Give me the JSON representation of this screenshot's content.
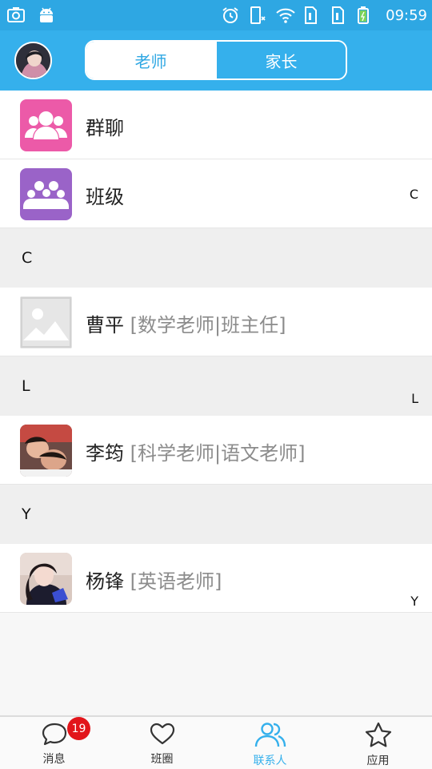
{
  "status_bar": {
    "time": "09:59",
    "left_icons": [
      "screenshot-icon",
      "android-icon"
    ],
    "right_icons": [
      "alarm-icon",
      "sim-call-icon",
      "wifi-icon",
      "sim1-icon",
      "sim2-icon",
      "battery-icon"
    ]
  },
  "header": {
    "tabs": [
      {
        "label": "老师",
        "active": true
      },
      {
        "label": "家长",
        "active": false
      }
    ]
  },
  "entries": [
    {
      "label": "群聊",
      "icon": "group-chat-icon",
      "color": "#ec5aa8"
    },
    {
      "label": "班级",
      "icon": "class-icon",
      "color": "#9a63c8",
      "index": "C"
    }
  ],
  "sections": [
    {
      "letter": "C",
      "contacts": [
        {
          "name": "曹平",
          "role": "[数学老师|班主任]",
          "avatar": "placeholder-image-icon"
        }
      ],
      "index": "L"
    },
    {
      "letter": "L",
      "contacts": [
        {
          "name": "李筠",
          "role": "[科学老师|语文老师]",
          "avatar": "photo-avatar"
        }
      ]
    },
    {
      "letter": "Y",
      "contacts": [
        {
          "name": "杨锋",
          "role": "[英语老师]",
          "avatar": "photo-avatar",
          "index": "Y"
        }
      ]
    }
  ],
  "bottom_nav": [
    {
      "label": "消息",
      "icon": "message-icon",
      "badge": "19",
      "active": false
    },
    {
      "label": "班圈",
      "icon": "heart-icon",
      "active": false
    },
    {
      "label": "联系人",
      "icon": "contacts-icon",
      "active": true
    },
    {
      "label": "应用",
      "icon": "star-icon",
      "active": false
    }
  ],
  "colors": {
    "primary": "#35b0ec",
    "status_bar": "#2ea7e3",
    "badge": "#e2151b",
    "group_chat": "#ec5aa8",
    "class": "#9a63c8"
  }
}
